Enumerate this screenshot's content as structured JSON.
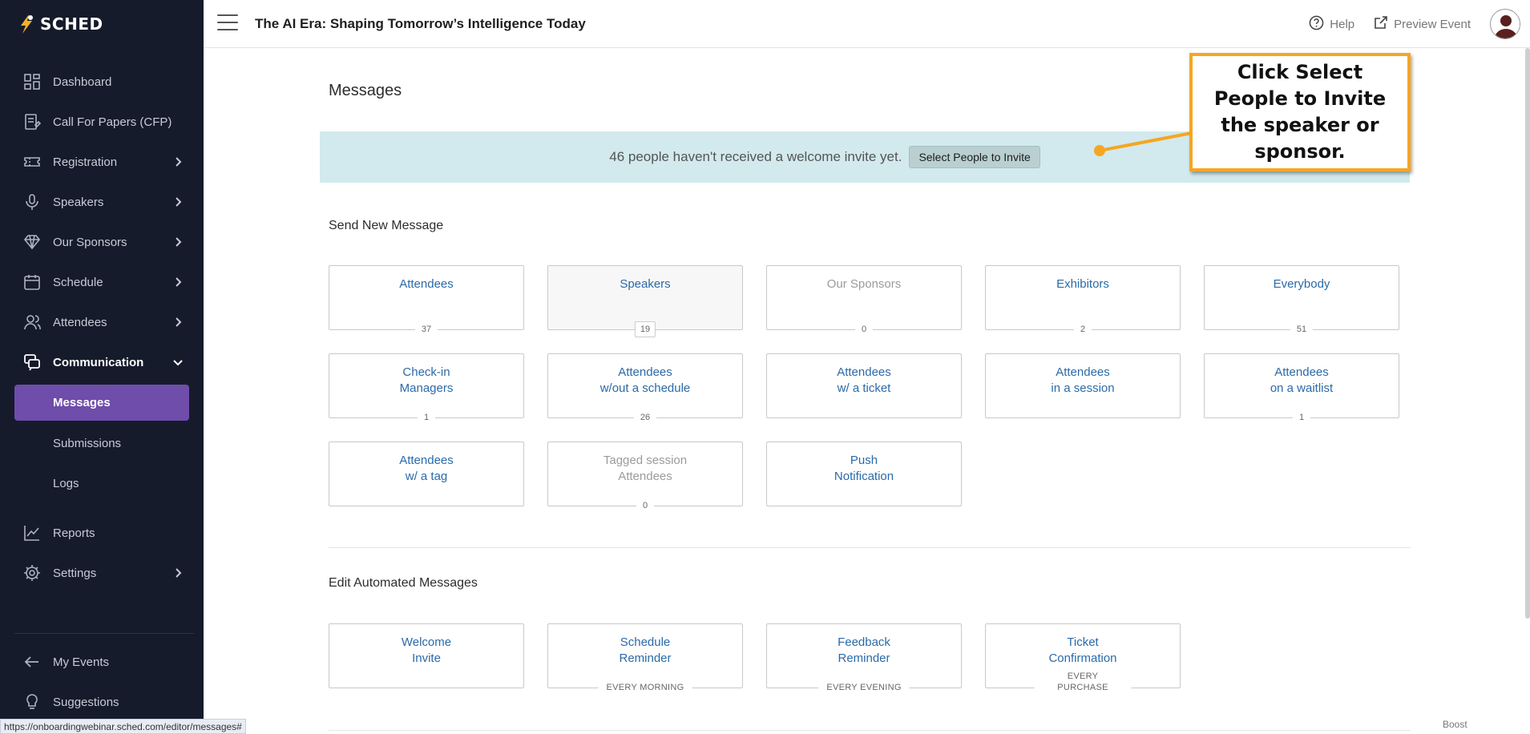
{
  "app": {
    "logo_text": "SCHED"
  },
  "header": {
    "event_title": "The AI Era: Shaping Tomorrow’s Intelligence Today",
    "help_label": "Help",
    "preview_label": "Preview Event"
  },
  "sidebar": {
    "items": [
      {
        "label": "Dashboard",
        "icon": "dashboard-icon"
      },
      {
        "label": "Call For Papers (CFP)",
        "icon": "cfp-icon"
      },
      {
        "label": "Registration",
        "icon": "ticket-icon"
      },
      {
        "label": "Speakers",
        "icon": "microphone-icon"
      },
      {
        "label": "Our Sponsors",
        "icon": "diamond-icon"
      },
      {
        "label": "Schedule",
        "icon": "calendar-icon"
      },
      {
        "label": "Attendees",
        "icon": "people-icon"
      },
      {
        "label": "Communication",
        "icon": "chat-icon"
      }
    ],
    "sub_items": [
      {
        "label": "Messages"
      },
      {
        "label": "Submissions"
      },
      {
        "label": "Logs"
      }
    ],
    "items_after": [
      {
        "label": "Reports",
        "icon": "chart-icon"
      },
      {
        "label": "Settings",
        "icon": "gear-icon"
      }
    ],
    "bottom": [
      {
        "label": "My Events",
        "icon": "arrow-left-icon"
      },
      {
        "label": "Suggestions",
        "icon": "lightbulb-icon"
      }
    ]
  },
  "main": {
    "title": "Messages",
    "banner": {
      "text": "46 people haven't received a welcome invite yet.",
      "button_label": "Select People to Invite"
    },
    "send_section_title": "Send New Message",
    "send_tiles": [
      {
        "label": "Attendees",
        "count": "37"
      },
      {
        "label": "Speakers",
        "count": "19"
      },
      {
        "label": "Our Sponsors",
        "count": "0"
      },
      {
        "label": "Exhibitors",
        "count": "2"
      },
      {
        "label": "Everybody",
        "count": "51"
      },
      {
        "label": "Check-in\nManagers",
        "count": "1"
      },
      {
        "label": "Attendees\nw/out a schedule",
        "count": "26"
      },
      {
        "label": "Attendees\nw/ a ticket",
        "count": ""
      },
      {
        "label": "Attendees\nin a session",
        "count": ""
      },
      {
        "label": "Attendees\non a waitlist",
        "count": "1"
      },
      {
        "label": "Attendees\nw/ a tag",
        "count": ""
      },
      {
        "label": "Tagged session\nAttendees",
        "count": "0"
      },
      {
        "label": "Push\nNotification",
        "count": ""
      }
    ],
    "auto_section_title": "Edit Automated Messages",
    "auto_tiles": [
      {
        "label": "Welcome\nInvite",
        "freq": ""
      },
      {
        "label": "Schedule\nReminder",
        "freq": "EVERY MORNING"
      },
      {
        "label": "Feedback\nReminder",
        "freq": "EVERY EVENING"
      },
      {
        "label": "Ticket\nConfirmation",
        "freq": "EVERY PURCHASE"
      }
    ]
  },
  "callout": {
    "text": "Click Select People to Invite the speaker or sponsor."
  },
  "status_bar": {
    "url": "https://onboardingwebinar.sched.com/editor/messages#"
  },
  "footer": {
    "boost_label": "Boost"
  },
  "colors": {
    "sidebar_bg": "#161b2b",
    "accent_purple": "#6e4dab",
    "link_blue": "#2b6aa8",
    "banner_bg": "#d2eaed",
    "callout_border": "#f5a623"
  }
}
